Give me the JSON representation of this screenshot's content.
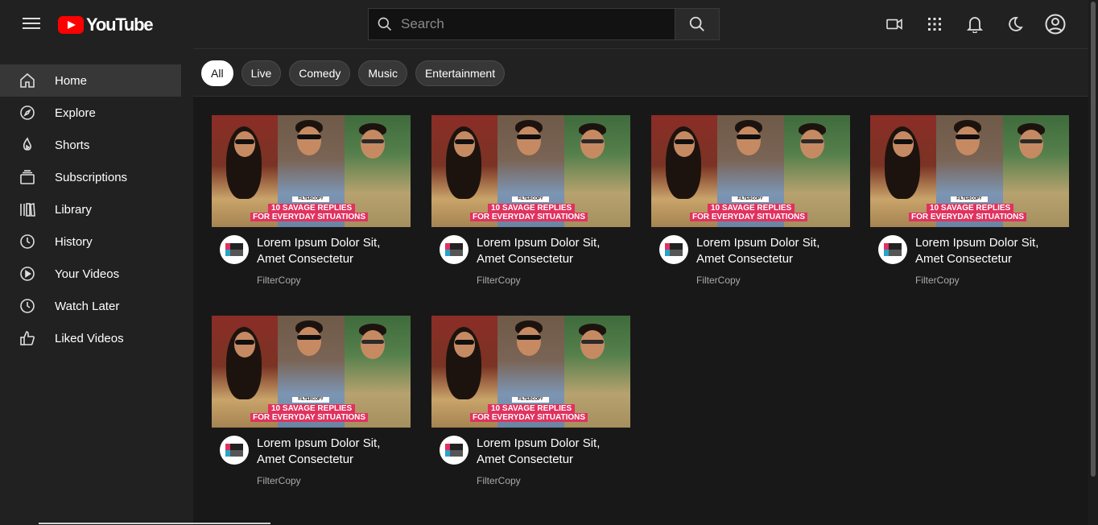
{
  "header": {
    "logo_text": "YouTube",
    "search_placeholder": "Search",
    "icons": [
      "video-camera-icon",
      "apps-grid-icon",
      "bell-icon",
      "moon-icon",
      "account-icon"
    ]
  },
  "sidebar": {
    "items": [
      {
        "label": "Home",
        "icon": "home-icon",
        "active": true
      },
      {
        "label": "Explore",
        "icon": "compass-icon",
        "active": false
      },
      {
        "label": "Shorts",
        "icon": "shorts-icon",
        "active": false
      },
      {
        "label": "Subscriptions",
        "icon": "subscriptions-icon",
        "active": false
      },
      {
        "label": "Library",
        "icon": "library-icon",
        "active": false
      },
      {
        "label": "History",
        "icon": "history-icon",
        "active": false
      },
      {
        "label": "Your Videos",
        "icon": "play-circle-icon",
        "active": false
      },
      {
        "label": "Watch Later",
        "icon": "clock-icon",
        "active": false
      },
      {
        "label": "Liked Videos",
        "icon": "thumbs-up-icon",
        "active": false
      }
    ]
  },
  "chips": [
    {
      "label": "All",
      "active": true
    },
    {
      "label": "Live",
      "active": false
    },
    {
      "label": "Comedy",
      "active": false
    },
    {
      "label": "Music",
      "active": false
    },
    {
      "label": "Entertainment",
      "active": false
    }
  ],
  "videos": [
    {
      "title_line1": "Lorem Ipsum Dolor Sit,",
      "title_line2": "Amet Consectetur",
      "channel": "FilterCopy",
      "thumb_brand": "FILTERCOPY",
      "thumb_caption_1": "10 SAVAGE REPLIES",
      "thumb_caption_2": "FOR EVERYDAY SITUATIONS"
    },
    {
      "title_line1": "Lorem Ipsum Dolor Sit,",
      "title_line2": "Amet Consectetur",
      "channel": "FilterCopy",
      "thumb_brand": "FILTERCOPY",
      "thumb_caption_1": "10 SAVAGE REPLIES",
      "thumb_caption_2": "FOR EVERYDAY SITUATIONS"
    },
    {
      "title_line1": "Lorem Ipsum Dolor Sit,",
      "title_line2": "Amet Consectetur",
      "channel": "FilterCopy",
      "thumb_brand": "FILTERCOPY",
      "thumb_caption_1": "10 SAVAGE REPLIES",
      "thumb_caption_2": "FOR EVERYDAY SITUATIONS"
    },
    {
      "title_line1": "Lorem Ipsum Dolor Sit,",
      "title_line2": "Amet Consectetur",
      "channel": "FilterCopy",
      "thumb_brand": "FILTERCOPY",
      "thumb_caption_1": "10 SAVAGE REPLIES",
      "thumb_caption_2": "FOR EVERYDAY SITUATIONS"
    },
    {
      "title_line1": "Lorem Ipsum Dolor Sit,",
      "title_line2": "Amet Consectetur",
      "channel": "FilterCopy",
      "thumb_brand": "FILTERCOPY",
      "thumb_caption_1": "10 SAVAGE REPLIES",
      "thumb_caption_2": "FOR EVERYDAY SITUATIONS"
    },
    {
      "title_line1": "Lorem Ipsum Dolor Sit,",
      "title_line2": "Amet Consectetur",
      "channel": "FilterCopy",
      "thumb_brand": "FILTERCOPY",
      "thumb_caption_1": "10 SAVAGE REPLIES",
      "thumb_caption_2": "FOR EVERYDAY SITUATIONS"
    }
  ],
  "colors": {
    "brand_red": "#ff0000",
    "background": "#181818",
    "surface": "#212121",
    "active_item": "#373737",
    "caption_pink": "#e0325f"
  }
}
